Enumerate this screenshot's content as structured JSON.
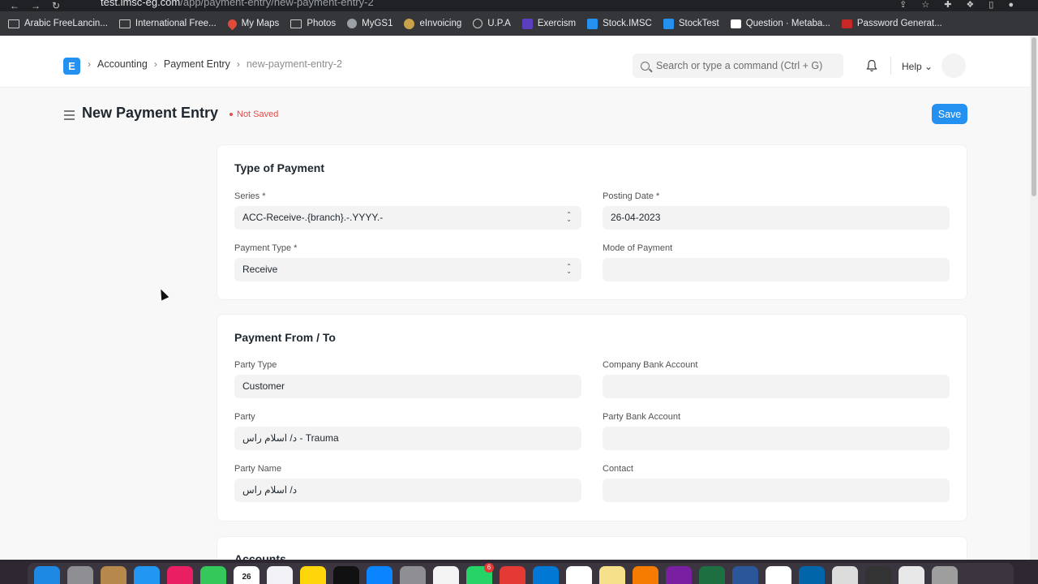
{
  "browser": {
    "url_host": "test.imsc-eg.com",
    "url_path": "/app/payment-entry/new-payment-entry-2",
    "bookmarks": [
      {
        "label": "Arabic FreeLancin...",
        "icon": "folder-icon"
      },
      {
        "label": "International Free...",
        "icon": "folder-icon"
      },
      {
        "label": "My Maps",
        "icon": "map-pin-icon"
      },
      {
        "label": "Photos",
        "icon": "folder-icon"
      },
      {
        "label": "MyGS1",
        "icon": "site-icon"
      },
      {
        "label": "eInvoicing",
        "icon": "coin-icon"
      },
      {
        "label": "U.P.A",
        "icon": "globe-icon"
      },
      {
        "label": "Exercism",
        "icon": "exercism-icon"
      },
      {
        "label": "Stock.IMSC",
        "icon": "erpnext-icon"
      },
      {
        "label": "StockTest",
        "icon": "erpnext-icon"
      },
      {
        "label": "Question · Metaba...",
        "icon": "gmail-icon"
      },
      {
        "label": "Password Generat...",
        "icon": "password-icon"
      }
    ]
  },
  "navbar": {
    "logo_letter": "E",
    "breadcrumb": [
      "Accounting",
      "Payment Entry",
      "new-payment-entry-2"
    ],
    "search_placeholder": "Search or type a command (Ctrl + G)",
    "help_label": "Help"
  },
  "page": {
    "title": "New Payment Entry",
    "status": "Not Saved",
    "save_label": "Save"
  },
  "sections": {
    "type_of_payment": {
      "heading": "Type of Payment",
      "series_label": "Series *",
      "series_value": "ACC-Receive-.{branch}.-.YYYY.-",
      "posting_date_label": "Posting Date *",
      "posting_date_value": "26-04-2023",
      "payment_type_label": "Payment Type *",
      "payment_type_value": "Receive",
      "mode_of_payment_label": "Mode of Payment",
      "mode_of_payment_value": ""
    },
    "payment_from_to": {
      "heading": "Payment From / To",
      "party_type_label": "Party Type",
      "party_type_value": "Customer",
      "company_bank_label": "Company Bank Account",
      "company_bank_value": "",
      "party_label": "Party",
      "party_value": "د/ اسلام راس - Trauma",
      "party_bank_label": "Party Bank Account",
      "party_bank_value": "",
      "party_name_label": "Party Name",
      "party_name_value": "د/ اسلام راس",
      "contact_label": "Contact",
      "contact_value": ""
    },
    "accounts": {
      "heading": "Accounts"
    }
  },
  "dock": {
    "calendar_month": "APR",
    "calendar_day": "26",
    "whatsapp_badge": "6"
  },
  "colors": {
    "primary": "#2490ef",
    "not_saved": "#e24c4c"
  }
}
